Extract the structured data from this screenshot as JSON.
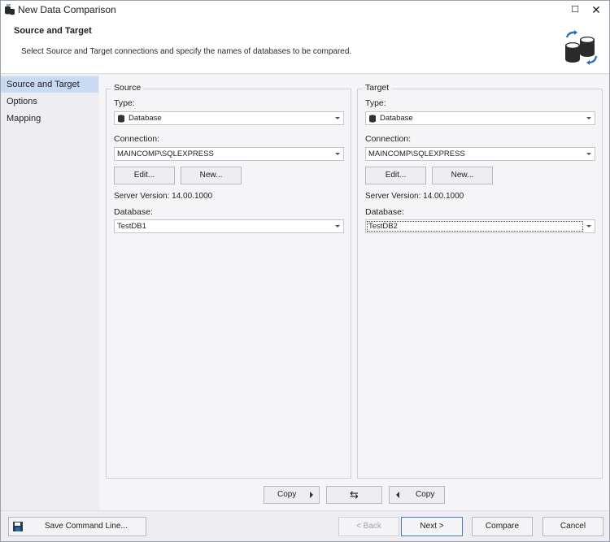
{
  "window": {
    "title": "New Data Comparison",
    "maximize_glyph": "☐",
    "close_glyph": "✕"
  },
  "header": {
    "title": "Source and Target",
    "subtitle": "Select Source and Target connections and specify the names of databases to be compared.",
    "icon": "database-sync-icon"
  },
  "nav": {
    "items": [
      {
        "label": "Source and Target",
        "active": true
      },
      {
        "label": "Options",
        "active": false
      },
      {
        "label": "Mapping",
        "active": false
      }
    ]
  },
  "source": {
    "title": "Source",
    "type_label": "Type:",
    "type_value": "Database",
    "connection_label": "Connection:",
    "connection_value": "MAINCOMP\\SQLEXPRESS",
    "edit_label": "Edit...",
    "new_label": "New...",
    "server_version": "Server Version: 14.00.1000",
    "database_label": "Database:",
    "database_value": "TestDB1"
  },
  "target": {
    "title": "Target",
    "type_label": "Type:",
    "type_value": "Database",
    "connection_label": "Connection:",
    "connection_value": "MAINCOMP\\SQLEXPRESS",
    "edit_label": "Edit...",
    "new_label": "New...",
    "server_version": "Server Version: 14.00.1000",
    "database_label": "Database:",
    "database_value": "TestDB2"
  },
  "copy_row": {
    "copy_right_label": "Copy",
    "swap_glyph": "⇆",
    "copy_left_label": "Copy"
  },
  "footer": {
    "save_label": "Save Command Line...",
    "back_label": "< Back",
    "next_label": "Next >",
    "compare_label": "Compare",
    "cancel_label": "Cancel"
  },
  "colors": {
    "nav_active": "#c9dbf2",
    "accent_blue": "#1f6fb8",
    "icon_dark": "#2b2b2b"
  }
}
